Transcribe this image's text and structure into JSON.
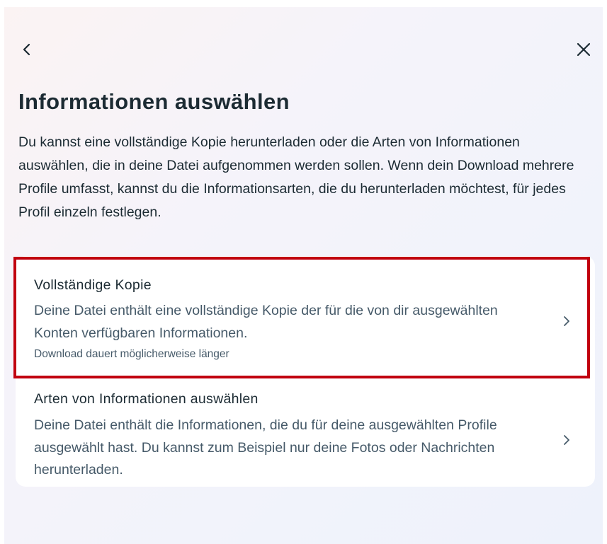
{
  "header": {
    "back_icon": "chevron-left-icon",
    "close_icon": "close-icon"
  },
  "title": "Informationen auswählen",
  "description": "Du kannst eine vollständige Kopie herunterladen oder die Arten von Informationen auswählen, die in deine Datei aufgenommen werden sollen. Wenn dein Download mehrere Profile umfasst, kannst du die Informationsarten, die du herunterladen möchtest, für jedes Profil einzeln festlegen.",
  "options": [
    {
      "title": "Vollständige Kopie",
      "description": "Deine Datei enthält eine vollständige Kopie der für die von dir ausgewählten Konten verfügbaren Informationen.",
      "note": "Download dauert möglicherweise länger",
      "icon": "chevron-right-icon",
      "highlighted": true,
      "highlight_color": "#c1000f"
    },
    {
      "title": "Arten von Informationen auswählen",
      "description": "Deine Datei enthält die Informationen, die du für deine ausgewählten Profile ausgewählt hast. Du kannst zum Beispiel nur deine Fotos oder Nachrichten herunterladen.",
      "icon": "chevron-right-icon",
      "highlighted": false
    }
  ],
  "colors": {
    "text_primary": "#1c2b33",
    "text_secondary": "#465a69",
    "highlight": "#c1000f"
  }
}
